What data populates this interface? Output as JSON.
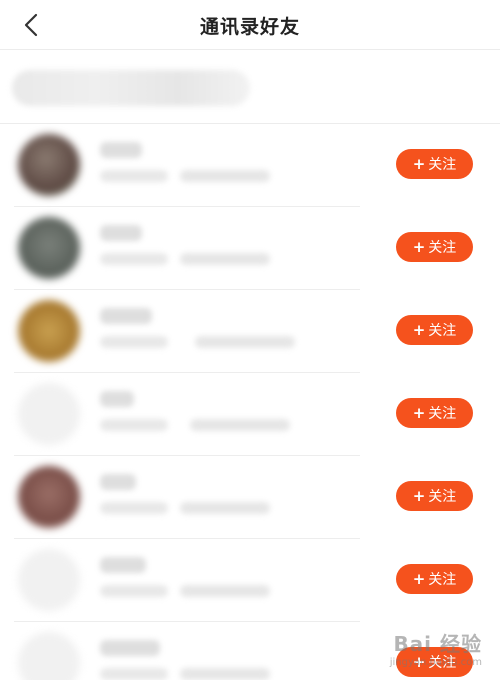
{
  "header": {
    "title": "通讯录好友",
    "back_icon": "chevron-left-icon"
  },
  "contacts": [
    {
      "avatar_color": "#6e5a52",
      "follow_label": "关注"
    },
    {
      "avatar_color": "#6a7068",
      "follow_label": "关注"
    },
    {
      "avatar_color": "#b88a3a",
      "follow_label": "关注"
    },
    {
      "avatar_color": "#f2f2f2",
      "follow_label": "关注"
    },
    {
      "avatar_color": "#8a5e56",
      "follow_label": "关注"
    },
    {
      "avatar_color": "#f2f2f2",
      "follow_label": "关注"
    },
    {
      "avatar_color": "#f2f2f2",
      "follow_label": "关注"
    }
  ],
  "accent_color": "#f5521d",
  "watermark": {
    "main": "Bai 经验",
    "sub": "jingyan.baidu.com"
  }
}
